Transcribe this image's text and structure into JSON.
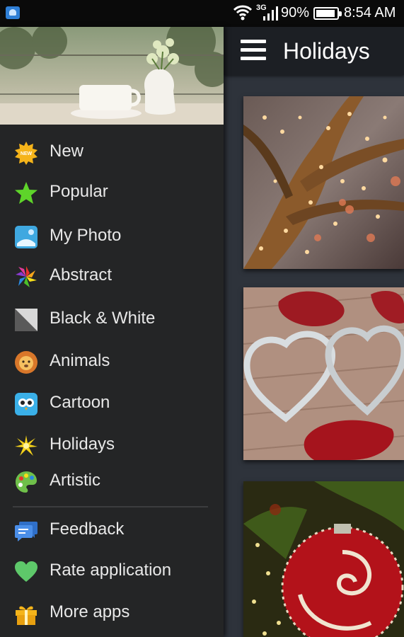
{
  "status_bar": {
    "network": "3G",
    "battery_percent": "90%",
    "battery_level": 0.9,
    "time": "8:54 AM"
  },
  "app_bar": {
    "title": "Holidays",
    "menu_icon": "hamburger-icon"
  },
  "drawer": {
    "header_image": "coffee-cup-and-flowers-photo",
    "categories": [
      {
        "label": "New",
        "icon": "new-badge-icon"
      },
      {
        "label": "Popular",
        "icon": "star-icon"
      },
      {
        "label": "My Photo",
        "icon": "photo-icon"
      },
      {
        "label": "Abstract",
        "icon": "pinwheel-icon"
      },
      {
        "label": "Black & White",
        "icon": "black-white-icon"
      },
      {
        "label": "Animals",
        "icon": "lion-icon"
      },
      {
        "label": "Cartoon",
        "icon": "owl-icon"
      },
      {
        "label": "Holidays",
        "icon": "firework-icon"
      },
      {
        "label": "Artistic",
        "icon": "palette-icon"
      }
    ],
    "actions": [
      {
        "label": "Feedback",
        "icon": "chat-bubble-icon"
      },
      {
        "label": "Rate application",
        "icon": "heart-icon"
      },
      {
        "label": "More apps",
        "icon": "gift-icon"
      }
    ]
  },
  "wallpapers": [
    {
      "image": "fairy-lights-on-tree-photo"
    },
    {
      "image": "heart-cookie-cutters-with-rose-petals-photo"
    },
    {
      "image": "red-christmas-ornament-photo"
    }
  ],
  "colors": {
    "drawer_bg": "#242526",
    "appbar_bg": "#1c1f24",
    "content_bg": "#2e333b"
  }
}
